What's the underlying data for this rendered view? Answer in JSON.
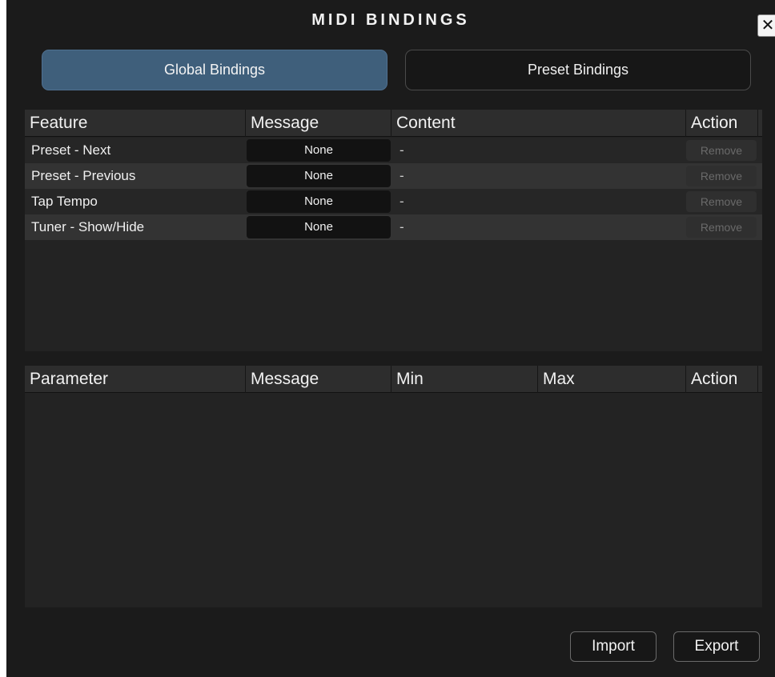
{
  "window": {
    "title": "MIDI BINDINGS",
    "close_icon": "✕"
  },
  "tabs": [
    {
      "label": "Global Bindings",
      "active": true
    },
    {
      "label": "Preset Bindings",
      "active": false
    }
  ],
  "features_table": {
    "headers": [
      "Feature",
      "Message",
      "Content",
      "Action"
    ],
    "rows": [
      {
        "feature": "Preset - Next",
        "message": "None",
        "content": "-",
        "action": "Remove"
      },
      {
        "feature": "Preset - Previous",
        "message": "None",
        "content": "-",
        "action": "Remove"
      },
      {
        "feature": "Tap Tempo",
        "message": "None",
        "content": "-",
        "action": "Remove"
      },
      {
        "feature": "Tuner - Show/Hide",
        "message": "None",
        "content": "-",
        "action": "Remove"
      }
    ]
  },
  "parameters_table": {
    "headers": [
      "Parameter",
      "Message",
      "Min",
      "Max",
      "Action"
    ],
    "rows": []
  },
  "footer": {
    "import_label": "Import",
    "export_label": "Export"
  },
  "colors": {
    "background": "#1b1b1b",
    "active_tab": "#3f5f7b",
    "panel": "#232323",
    "header": "#2d2d2d",
    "row_alt": "#333333"
  }
}
